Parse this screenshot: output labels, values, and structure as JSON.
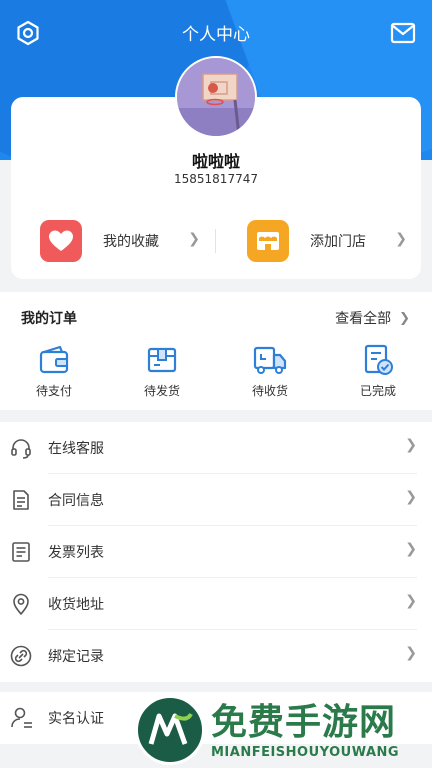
{
  "header": {
    "title": "个人中心"
  },
  "profile": {
    "name": "啦啦啦",
    "phone": "15851817747"
  },
  "quick_links": [
    {
      "label": "我的收藏",
      "icon": "heart-icon",
      "color": "#f05a5a"
    },
    {
      "label": "添加门店",
      "icon": "store-icon",
      "color": "#f5a623"
    }
  ],
  "orders": {
    "title": "我的订单",
    "view_all": "查看全部",
    "items": [
      {
        "label": "待支付",
        "icon": "wallet-icon"
      },
      {
        "label": "待发货",
        "icon": "package-icon"
      },
      {
        "label": "待收货",
        "icon": "truck-icon"
      },
      {
        "label": "已完成",
        "icon": "completed-icon"
      }
    ]
  },
  "menu": [
    {
      "label": "在线客服",
      "icon": "headset-icon"
    },
    {
      "label": "合同信息",
      "icon": "document-icon"
    },
    {
      "label": "发票列表",
      "icon": "invoice-icon"
    },
    {
      "label": "收货地址",
      "icon": "location-icon"
    },
    {
      "label": "绑定记录",
      "icon": "link-icon"
    }
  ],
  "auth": {
    "label": "实名认证",
    "icon": "user-verify-icon"
  },
  "watermark": {
    "title": "免费手游网",
    "subtitle": "MIANFEISHOUYOUWANG"
  },
  "colors": {
    "primary": "#1e87f0",
    "icon_blue": "#2e7fd8",
    "background": "#f2f3f5"
  }
}
